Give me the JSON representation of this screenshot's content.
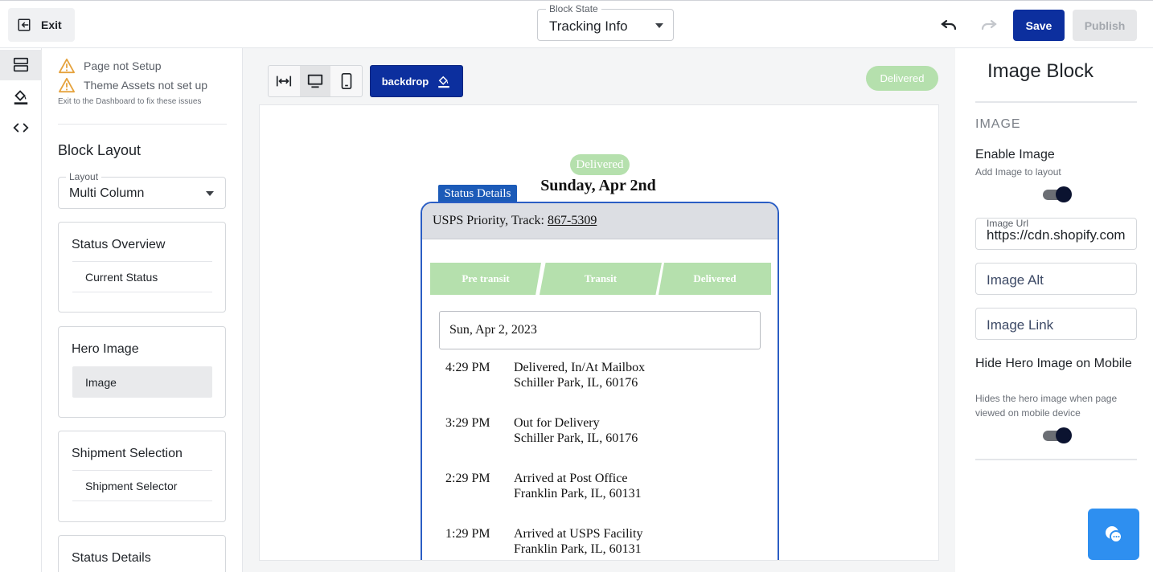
{
  "topbar": {
    "exit_label": "Exit",
    "block_state_legend": "Block State",
    "block_state_value": "Tracking Info",
    "save_label": "Save",
    "publish_label": "Publish"
  },
  "rail": {
    "items": [
      "layout-icon",
      "paint-bucket-icon",
      "code-icon"
    ],
    "active": "layout-icon"
  },
  "left_panel": {
    "warnings": [
      "Page not Setup",
      "Theme Assets not set up"
    ],
    "warning_note": "Exit to the Dashboard to fix these issues",
    "block_layout_title": "Block Layout",
    "layout_legend": "Layout",
    "layout_value": "Multi Column",
    "groups": [
      {
        "title": "Status Overview",
        "item": "Current Status"
      },
      {
        "title": "Hero Image",
        "item": "Image"
      },
      {
        "title": "Shipment Selection",
        "item": "Shipment Selector"
      },
      {
        "title": "Status Details"
      }
    ]
  },
  "canvas": {
    "backdrop_label": "backdrop",
    "status_pill": "Delivered",
    "preview": {
      "status_pill": "Delivered",
      "date_heading": "Sunday, Apr 2nd",
      "status_tag": "Status Details",
      "carrier_text": "USPS Priority, Track: ",
      "tracking_number": "867-5309",
      "steps": [
        "Pre transit",
        "Transit",
        "Delivered"
      ],
      "date_box": "Sun, Apr 2, 2023",
      "events": [
        {
          "time": "4:29 PM",
          "status": "Delivered, In/At Mailbox",
          "location": "Schiller Park, IL, 60176"
        },
        {
          "time": "3:29 PM",
          "status": "Out for Delivery",
          "location": "Schiller Park, IL, 60176"
        },
        {
          "time": "2:29 PM",
          "status": "Arrived at Post Office",
          "location": "Franklin Park, IL, 60131"
        },
        {
          "time": "1:29 PM",
          "status": "Arrived at USPS Facility",
          "location": "Franklin Park, IL, 60131"
        }
      ]
    }
  },
  "right_panel": {
    "title": "Image Block",
    "section": "IMAGE",
    "enable_label": "Enable Image",
    "enable_sub": "Add Image to layout",
    "enable_on": true,
    "image_url_legend": "Image Url",
    "image_url_value": "https://cdn.shopify.com",
    "image_alt_placeholder": "Image Alt",
    "image_link_placeholder": "Image Link",
    "hide_mobile_label": "Hide Hero Image on Mobile",
    "hide_mobile_sub": "Hides the hero image when page viewed on mobile device",
    "hide_mobile_on": true
  },
  "colors": {
    "primary": "#0c2f9e",
    "delivered_green": "#b5e0ad",
    "track_border": "#2b5ec4",
    "status_tag": "#1c5bb8",
    "chat": "#2e8ff0"
  }
}
